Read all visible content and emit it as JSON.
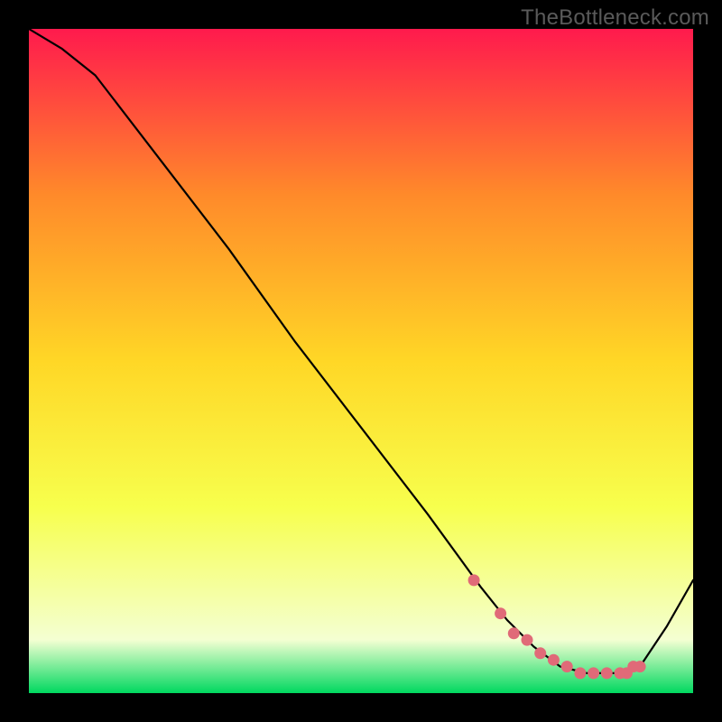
{
  "watermark": "TheBottleneck.com",
  "colors": {
    "background": "#000000",
    "gradient_top": "#ff1a4d",
    "gradient_mid_upper": "#ff8a2a",
    "gradient_mid": "#ffd726",
    "gradient_lower": "#f7ff4d",
    "gradient_pale": "#f4ffd2",
    "gradient_bottom": "#00d85f",
    "curve": "#000000",
    "markers": "#e06a78"
  },
  "chart_data": {
    "type": "line",
    "title": "",
    "xlabel": "",
    "ylabel": "",
    "xlim": [
      0,
      100
    ],
    "ylim": [
      0,
      100
    ],
    "series": [
      {
        "name": "bottleneck-curve",
        "x": [
          0,
          5,
          10,
          20,
          30,
          40,
          50,
          60,
          68,
          72,
          76,
          80,
          84,
          88,
          90,
          92,
          96,
          100
        ],
        "y": [
          100,
          97,
          93,
          80,
          67,
          53,
          40,
          27,
          16,
          11,
          7,
          4,
          3,
          3,
          3,
          4,
          10,
          17
        ]
      }
    ],
    "markers": {
      "name": "optimal-range-markers",
      "x": [
        67,
        71,
        73,
        75,
        77,
        79,
        81,
        83,
        85,
        87,
        89,
        90,
        91,
        92
      ],
      "y": [
        17,
        12,
        9,
        8,
        6,
        5,
        4,
        3,
        3,
        3,
        3,
        3,
        4,
        4
      ]
    }
  }
}
